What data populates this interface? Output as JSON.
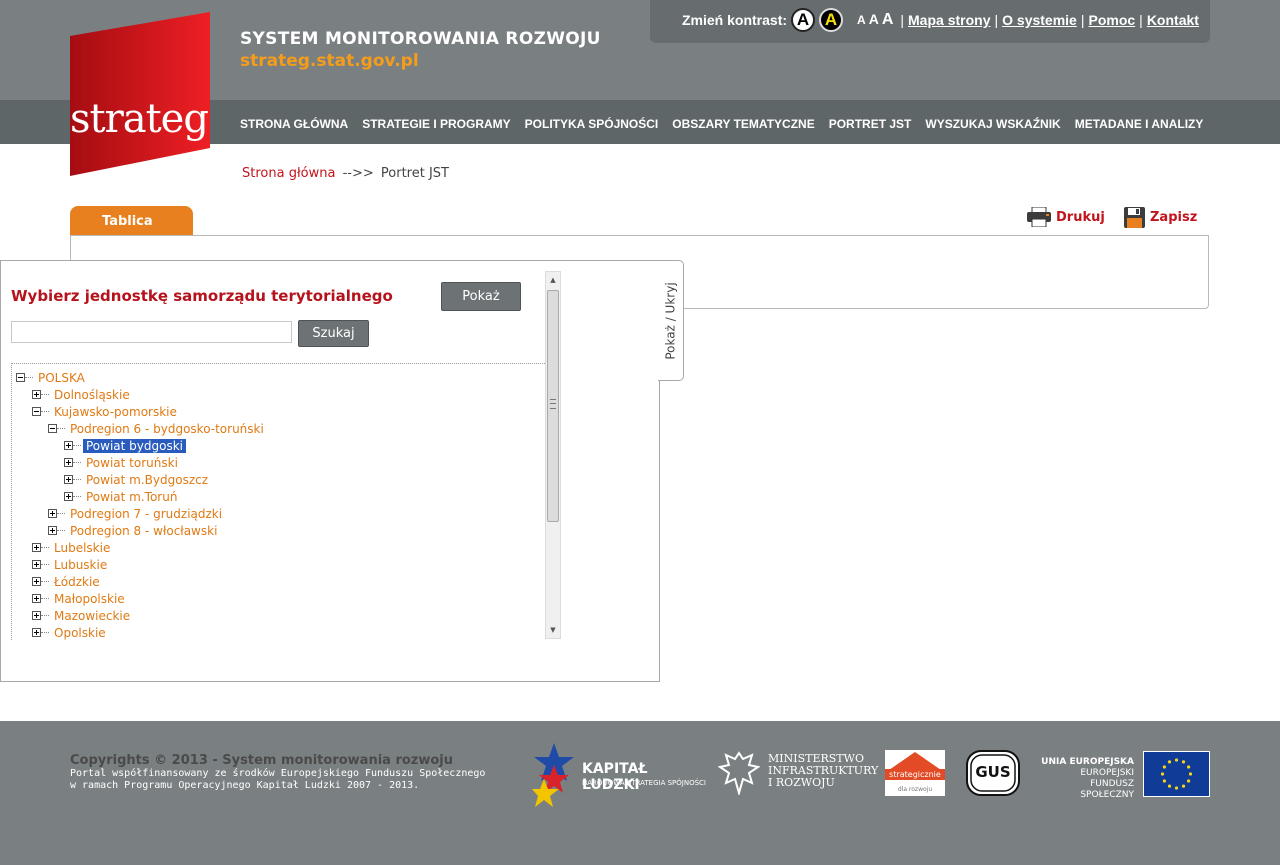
{
  "site": {
    "logo_text": "strateg",
    "title": "SYSTEM MONITOROWANIA ROZWOJU",
    "url": "strateg.stat.gov.pl"
  },
  "utility": {
    "contrast_label": "Zmień kontrast:",
    "contrast_normal": "A",
    "contrast_high": "A",
    "font_sizes": [
      "A",
      "A",
      "A"
    ],
    "separator": "|",
    "links": [
      "Mapa strony",
      "O systemie",
      "Pomoc",
      "Kontakt"
    ]
  },
  "nav": {
    "items": [
      "STRONA GŁÓWNA",
      "STRATEGIE I PROGRAMY",
      "POLITYKA SPÓJNOŚCI",
      "OBSZARY TEMATYCZNE",
      "PORTRET JST",
      "WYSZUKAJ WSKAŹNIK",
      "METADANE I ANALIZY"
    ]
  },
  "breadcrumb": {
    "home": "Strona główna",
    "separator": "-->>",
    "current": "Portret JST"
  },
  "tabs": {
    "active": "Tablica"
  },
  "actions": {
    "print": "Drukuj",
    "save": "Zapisz"
  },
  "panel": {
    "title": "Wybierz jednostkę samorządu terytorialnego",
    "show_button": "Pokaż",
    "search_value": "",
    "search_button": "Szukaj",
    "toggle_label": "Pokaż / Ukryj",
    "tree": [
      {
        "label": "POLSKA",
        "level": 0,
        "state": "minus",
        "selected": false
      },
      {
        "label": "Dolnośląskie",
        "level": 1,
        "state": "plus",
        "selected": false
      },
      {
        "label": "Kujawsko-pomorskie",
        "level": 1,
        "state": "minus",
        "selected": false
      },
      {
        "label": "Podregion 6 - bydgosko-toruński",
        "level": 2,
        "state": "minus",
        "selected": false
      },
      {
        "label": "Powiat bydgoski",
        "level": 3,
        "state": "plus",
        "selected": true
      },
      {
        "label": "Powiat toruński",
        "level": 3,
        "state": "plus",
        "selected": false
      },
      {
        "label": "Powiat m.Bydgoszcz",
        "level": 3,
        "state": "plus",
        "selected": false
      },
      {
        "label": "Powiat m.Toruń",
        "level": 3,
        "state": "plus",
        "selected": false
      },
      {
        "label": "Podregion 7 - grudziądzki",
        "level": 2,
        "state": "plus",
        "selected": false
      },
      {
        "label": "Podregion 8 - włocławski",
        "level": 2,
        "state": "plus",
        "selected": false
      },
      {
        "label": "Lubelskie",
        "level": 1,
        "state": "plus",
        "selected": false
      },
      {
        "label": "Lubuskie",
        "level": 1,
        "state": "plus",
        "selected": false
      },
      {
        "label": "Łódzkie",
        "level": 1,
        "state": "plus",
        "selected": false
      },
      {
        "label": "Małopolskie",
        "level": 1,
        "state": "plus",
        "selected": false
      },
      {
        "label": "Mazowieckie",
        "level": 1,
        "state": "plus",
        "selected": false
      },
      {
        "label": "Opolskie",
        "level": 1,
        "state": "plus",
        "selected": false
      }
    ]
  },
  "footer": {
    "copyright": "Copyrights © 2013 - System monitorowania rozwoju",
    "note_line1": "Portal współfinansowany ze środków Europejskiego Funduszu Społecznego",
    "note_line2": "w ramach Programu Operacyjnego Kapitał Ludzki 2007 - 2013.",
    "kl_title": "KAPITAŁ LUDZKI",
    "kl_sub": "NARODOWA STRATEGIA SPÓJNOŚCI",
    "ministry_line1": "MINISTERSTWO",
    "ministry_line2": "INFRASTRUKTURY",
    "ministry_line3": "I ROZWOJU",
    "strat_text1": "strategicznie",
    "strat_text2": "dla rozwoju",
    "gus_text": "GUS",
    "eu_line1": "UNIA EUROPEJSKA",
    "eu_line2": "EUROPEJSKI",
    "eu_line3": "FUNDUSZ SPOŁECZNY"
  },
  "colors": {
    "header_bg": "#7a8082",
    "nav_bg": "#5f6668",
    "accent_orange": "#e8801f",
    "accent_red": "#c1141c",
    "tree_link": "#e07a14",
    "selection": "#2a5cbf"
  }
}
